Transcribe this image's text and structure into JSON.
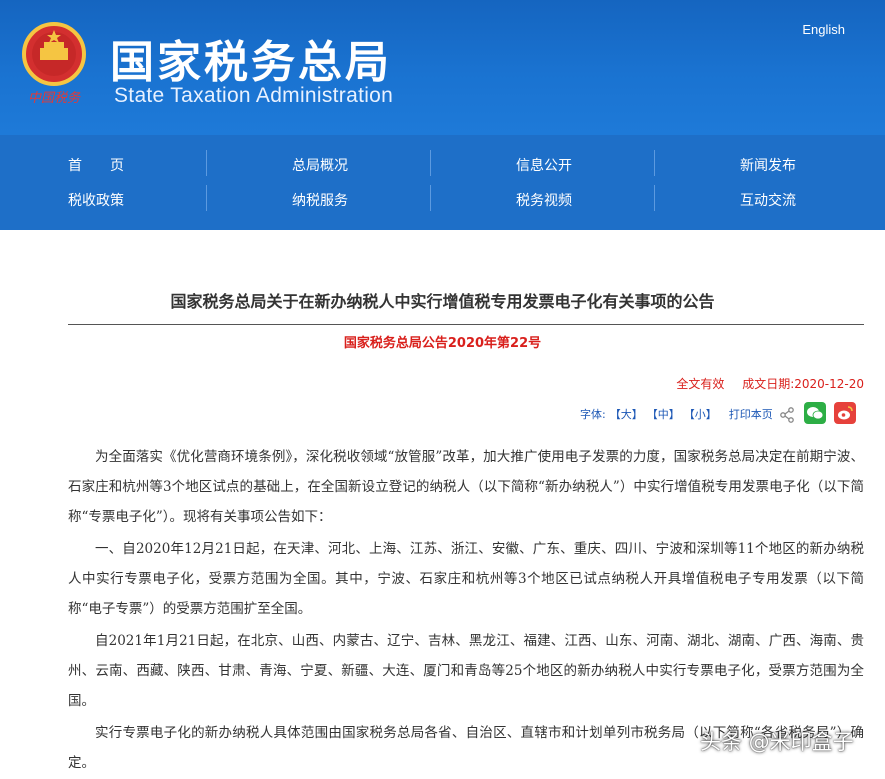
{
  "header": {
    "title_cn": "国家税务总局",
    "title_en": "State Taxation Administration",
    "emblem_label": "中国税务",
    "english_link": "English",
    "background": "#1a6fce"
  },
  "nav": {
    "row1": [
      "首　　页",
      "总局概况",
      "信息公开",
      "新闻发布"
    ],
    "row2": [
      "税收政策",
      "纳税服务",
      "税务视频",
      "互动交流"
    ]
  },
  "article": {
    "title": "国家税务总局关于在新办纳税人中实行增值税专用发票电子化有关事项的公告",
    "doc_number": "国家税务总局公告2020年第22号",
    "status": "全文有效",
    "date": "成文日期:2020-12-20",
    "font_label": "字体:",
    "font_sizes": [
      "【大】",
      "【中】",
      "【小】"
    ],
    "print": "打印本页",
    "paragraphs": [
      "为全面落实《优化营商环境条例》，深化税收领域“放管服”改革，加大推广使用电子发票的力度，国家税务总局决定在前期宁波、石家庄和杭州等3个地区试点的基础上，在全国新设立登记的纳税人（以下简称“新办纳税人”）中实行增值税专用发票电子化（以下简称“专票电子化”）。现将有关事项公告如下：",
      "一、自2020年12月21日起，在天津、河北、上海、江苏、浙江、安徽、广东、重庆、四川、宁波和深圳等11个地区的新办纳税人中实行专票电子化，受票方范围为全国。其中，宁波、石家庄和杭州等3个地区已试点纳税人开具增值税电子专用发票（以下简称“电子专票”）的受票方范围扩至全国。",
      "自2021年1月21日起，在北京、山西、内蒙古、辽宁、吉林、黑龙江、福建、江西、山东、河南、湖北、湖南、广西、海南、贵州、云南、西藏、陕西、甘肃、青海、宁夏、新疆、大连、厦门和青岛等25个地区的新办纳税人中实行专票电子化，受票方范围为全国。",
      "实行专票电子化的新办纳税人具体范围由国家税务总局各省、自治区、直辖市和计划单列市税务局（以下简称“各省税务局”）确定。"
    ]
  },
  "watermark": "头条 @米印盒子",
  "colors": {
    "accent_red": "#d9201c",
    "link_blue": "#1c57b5"
  }
}
